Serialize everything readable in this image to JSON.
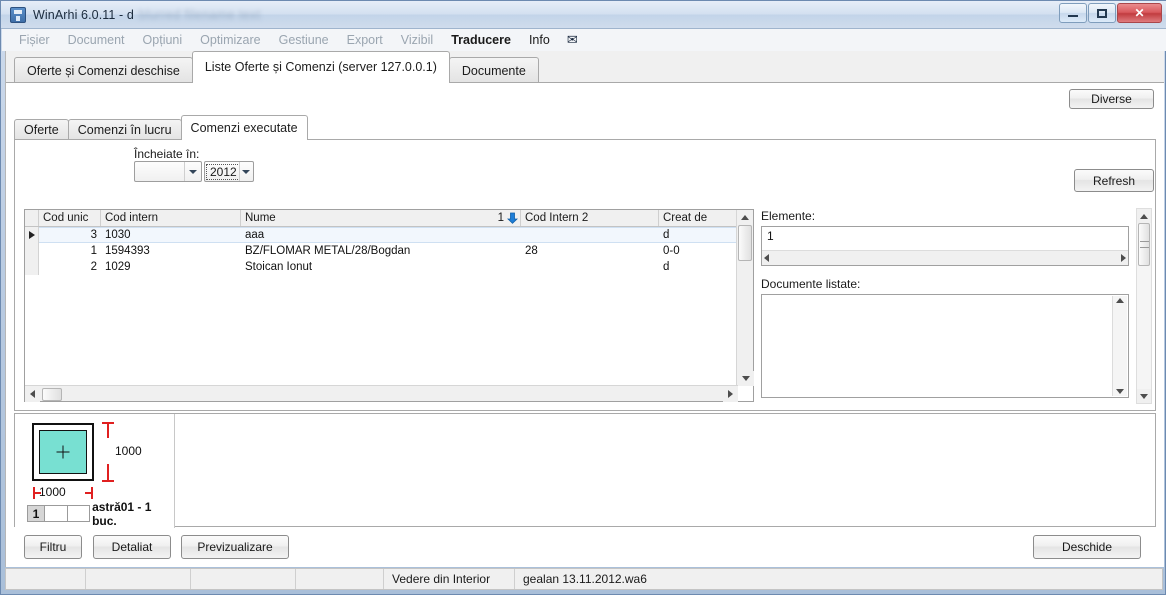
{
  "window": {
    "title": "WinArhi 6.0.11 - d",
    "title_blurred": "blurred filename text",
    "buttons": {
      "minimize": "minimize-icon",
      "maximize": "maximize-icon",
      "close": "✕"
    }
  },
  "menubar": {
    "items": [
      {
        "label": "Fișier",
        "state": "disabled"
      },
      {
        "label": "Document",
        "state": "disabled"
      },
      {
        "label": "Opțiuni",
        "state": "disabled"
      },
      {
        "label": "Optimizare",
        "state": "disabled"
      },
      {
        "label": "Gestiune",
        "state": "disabled"
      },
      {
        "label": "Export",
        "state": "disabled"
      },
      {
        "label": "Vizibil",
        "state": "disabled"
      },
      {
        "label": "Traducere",
        "state": "active"
      },
      {
        "label": "Info",
        "state": "enabled"
      }
    ],
    "mail_icon": "✉"
  },
  "tabs": {
    "outer": [
      {
        "label": "Oferte și Comenzi deschise",
        "active": false
      },
      {
        "label": "Liste Oferte și Comenzi   (server 127.0.0.1)",
        "active": true
      },
      {
        "label": "Documente",
        "active": false
      }
    ],
    "inner": [
      {
        "label": "Oferte",
        "active": false
      },
      {
        "label": "Comenzi în lucru",
        "active": false
      },
      {
        "label": "Comenzi executate",
        "active": true
      }
    ]
  },
  "toolbar": {
    "diverse_label": "Diverse",
    "refresh_label": "Refresh"
  },
  "filter": {
    "label": "Încheiate în:",
    "month_value": "",
    "year_value": "2012"
  },
  "grid": {
    "columns": [
      "Cod unic",
      "Cod intern",
      "Nume",
      "Cod Intern 2",
      "Creat de"
    ],
    "sort_indicator": "1",
    "rows": [
      {
        "selected": true,
        "cod_unic": "3",
        "cod_intern": "1030",
        "nume": "aaa",
        "cod_intern_2": "",
        "creat_de": "d"
      },
      {
        "selected": false,
        "cod_unic": "1",
        "cod_intern": "1594393",
        "nume": "BZ/FLOMAR METAL/28/Bogdan",
        "cod_intern_2": "28",
        "creat_de": "0-0"
      },
      {
        "selected": false,
        "cod_unic": "2",
        "cod_intern": "1029",
        "nume": "Stoican Ionut",
        "cod_intern_2": "",
        "creat_de": "d"
      }
    ]
  },
  "detail": {
    "elemente_label": "Elemente:",
    "elemente_items": [
      "1"
    ],
    "documente_label": "Documente listate:",
    "documente_items": []
  },
  "preview": {
    "width_dim": "1000",
    "height_dim": "1000",
    "caption_number": "1",
    "caption_text": "astră01 - 1 buc."
  },
  "actions": {
    "filtru": "Filtru",
    "detaliat": "Detaliat",
    "previzualizare": "Previzualizare",
    "deschide": "Deschide"
  },
  "statusbar": {
    "view": "Vedere din Interior",
    "file": "gealan 13.11.2012.wa6"
  },
  "colors": {
    "accent_blue": "#1e7ed8",
    "glass_green": "#78e0d2",
    "dimension_red": "#e02020",
    "close_red": "#c13c40"
  }
}
